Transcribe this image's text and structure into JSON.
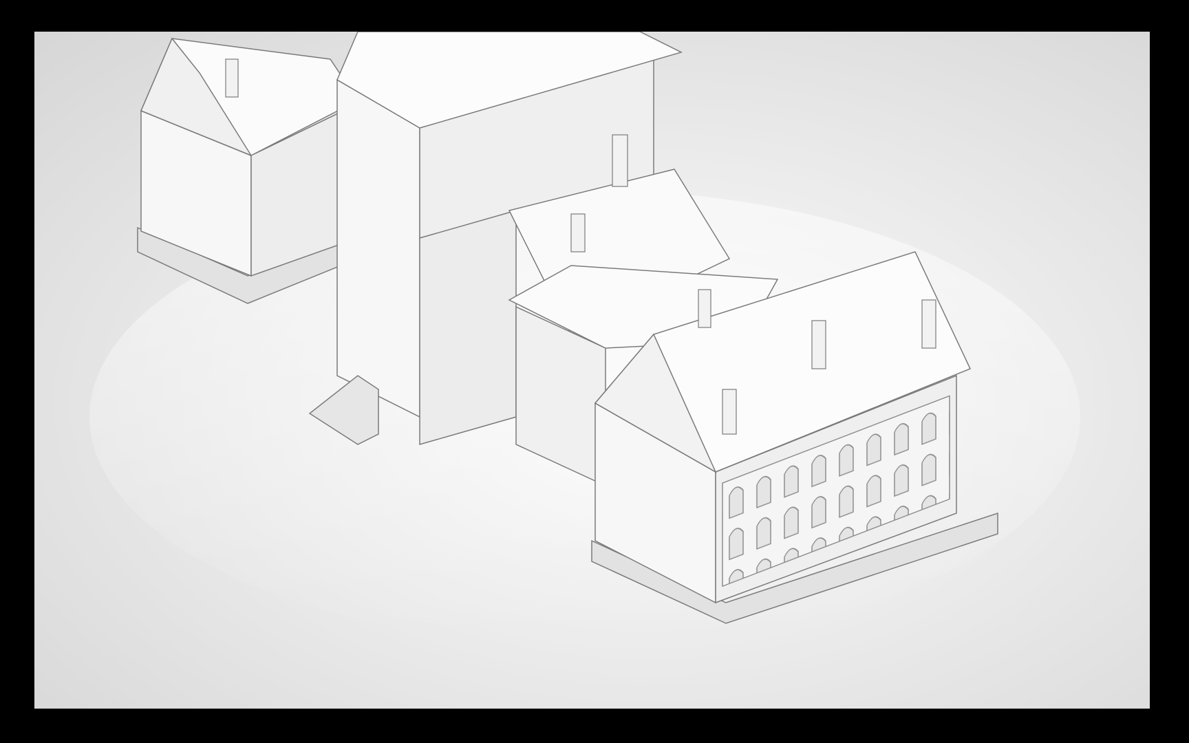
{
  "scene": {
    "subject_icon": "gothic-building-model-render",
    "style": "clay-render",
    "colors": {
      "frame": "#000000",
      "background": "#e6e6e6",
      "model": "#f7f7f7",
      "shade": "#d9d9d9",
      "line": "#7a7a7a"
    }
  }
}
